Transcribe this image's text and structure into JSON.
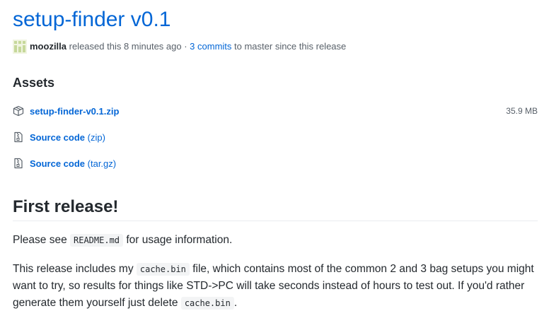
{
  "release": {
    "title": "setup-finder v0.1",
    "author": "moozilla",
    "released_text": " released this 8 minutes ago · ",
    "commits_link": "3 commits",
    "commits_suffix": " to master since this release"
  },
  "assets": {
    "heading": "Assets",
    "items": [
      {
        "name": "setup-finder-v0.1.zip",
        "suffix": "",
        "size": "35.9 MB",
        "icon": "package-icon"
      },
      {
        "name": "Source code",
        "suffix": " (zip)",
        "size": "",
        "icon": "file-zip-icon"
      },
      {
        "name": "Source code",
        "suffix": " (tar.gz)",
        "size": "",
        "icon": "file-zip-icon"
      }
    ]
  },
  "notes": {
    "heading": "First release!",
    "p1": {
      "before": "Please see ",
      "code": "README.md",
      "after": " for usage information."
    },
    "p2": {
      "before": "This release includes my ",
      "code1": "cache.bin",
      "middle": " file, which contains most of the common 2 and 3 bag setups you might want to try, so results for things like STD->PC will take seconds instead of hours to test out. If you'd rather generate them yourself just delete ",
      "code2": "cache.bin",
      "after": "."
    }
  },
  "colors": {
    "link": "#0366d6",
    "text": "#24292e",
    "muted": "#586069",
    "avatar": "#c6d89a"
  }
}
